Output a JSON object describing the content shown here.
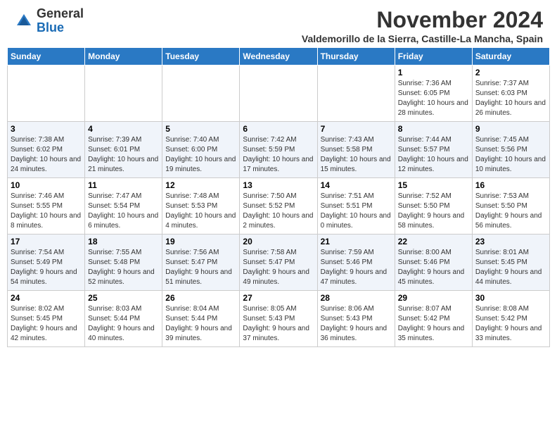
{
  "header": {
    "logo_general": "General",
    "logo_blue": "Blue",
    "month_title": "November 2024",
    "location": "Valdemorillo de la Sierra, Castille-La Mancha, Spain"
  },
  "days_of_week": [
    "Sunday",
    "Monday",
    "Tuesday",
    "Wednesday",
    "Thursday",
    "Friday",
    "Saturday"
  ],
  "weeks": [
    [
      {
        "num": "",
        "info": ""
      },
      {
        "num": "",
        "info": ""
      },
      {
        "num": "",
        "info": ""
      },
      {
        "num": "",
        "info": ""
      },
      {
        "num": "",
        "info": ""
      },
      {
        "num": "1",
        "info": "Sunrise: 7:36 AM\nSunset: 6:05 PM\nDaylight: 10 hours and 28 minutes."
      },
      {
        "num": "2",
        "info": "Sunrise: 7:37 AM\nSunset: 6:03 PM\nDaylight: 10 hours and 26 minutes."
      }
    ],
    [
      {
        "num": "3",
        "info": "Sunrise: 7:38 AM\nSunset: 6:02 PM\nDaylight: 10 hours and 24 minutes."
      },
      {
        "num": "4",
        "info": "Sunrise: 7:39 AM\nSunset: 6:01 PM\nDaylight: 10 hours and 21 minutes."
      },
      {
        "num": "5",
        "info": "Sunrise: 7:40 AM\nSunset: 6:00 PM\nDaylight: 10 hours and 19 minutes."
      },
      {
        "num": "6",
        "info": "Sunrise: 7:42 AM\nSunset: 5:59 PM\nDaylight: 10 hours and 17 minutes."
      },
      {
        "num": "7",
        "info": "Sunrise: 7:43 AM\nSunset: 5:58 PM\nDaylight: 10 hours and 15 minutes."
      },
      {
        "num": "8",
        "info": "Sunrise: 7:44 AM\nSunset: 5:57 PM\nDaylight: 10 hours and 12 minutes."
      },
      {
        "num": "9",
        "info": "Sunrise: 7:45 AM\nSunset: 5:56 PM\nDaylight: 10 hours and 10 minutes."
      }
    ],
    [
      {
        "num": "10",
        "info": "Sunrise: 7:46 AM\nSunset: 5:55 PM\nDaylight: 10 hours and 8 minutes."
      },
      {
        "num": "11",
        "info": "Sunrise: 7:47 AM\nSunset: 5:54 PM\nDaylight: 10 hours and 6 minutes."
      },
      {
        "num": "12",
        "info": "Sunrise: 7:48 AM\nSunset: 5:53 PM\nDaylight: 10 hours and 4 minutes."
      },
      {
        "num": "13",
        "info": "Sunrise: 7:50 AM\nSunset: 5:52 PM\nDaylight: 10 hours and 2 minutes."
      },
      {
        "num": "14",
        "info": "Sunrise: 7:51 AM\nSunset: 5:51 PM\nDaylight: 10 hours and 0 minutes."
      },
      {
        "num": "15",
        "info": "Sunrise: 7:52 AM\nSunset: 5:50 PM\nDaylight: 9 hours and 58 minutes."
      },
      {
        "num": "16",
        "info": "Sunrise: 7:53 AM\nSunset: 5:50 PM\nDaylight: 9 hours and 56 minutes."
      }
    ],
    [
      {
        "num": "17",
        "info": "Sunrise: 7:54 AM\nSunset: 5:49 PM\nDaylight: 9 hours and 54 minutes."
      },
      {
        "num": "18",
        "info": "Sunrise: 7:55 AM\nSunset: 5:48 PM\nDaylight: 9 hours and 52 minutes."
      },
      {
        "num": "19",
        "info": "Sunrise: 7:56 AM\nSunset: 5:47 PM\nDaylight: 9 hours and 51 minutes."
      },
      {
        "num": "20",
        "info": "Sunrise: 7:58 AM\nSunset: 5:47 PM\nDaylight: 9 hours and 49 minutes."
      },
      {
        "num": "21",
        "info": "Sunrise: 7:59 AM\nSunset: 5:46 PM\nDaylight: 9 hours and 47 minutes."
      },
      {
        "num": "22",
        "info": "Sunrise: 8:00 AM\nSunset: 5:46 PM\nDaylight: 9 hours and 45 minutes."
      },
      {
        "num": "23",
        "info": "Sunrise: 8:01 AM\nSunset: 5:45 PM\nDaylight: 9 hours and 44 minutes."
      }
    ],
    [
      {
        "num": "24",
        "info": "Sunrise: 8:02 AM\nSunset: 5:45 PM\nDaylight: 9 hours and 42 minutes."
      },
      {
        "num": "25",
        "info": "Sunrise: 8:03 AM\nSunset: 5:44 PM\nDaylight: 9 hours and 40 minutes."
      },
      {
        "num": "26",
        "info": "Sunrise: 8:04 AM\nSunset: 5:44 PM\nDaylight: 9 hours and 39 minutes."
      },
      {
        "num": "27",
        "info": "Sunrise: 8:05 AM\nSunset: 5:43 PM\nDaylight: 9 hours and 37 minutes."
      },
      {
        "num": "28",
        "info": "Sunrise: 8:06 AM\nSunset: 5:43 PM\nDaylight: 9 hours and 36 minutes."
      },
      {
        "num": "29",
        "info": "Sunrise: 8:07 AM\nSunset: 5:42 PM\nDaylight: 9 hours and 35 minutes."
      },
      {
        "num": "30",
        "info": "Sunrise: 8:08 AM\nSunset: 5:42 PM\nDaylight: 9 hours and 33 minutes."
      }
    ]
  ]
}
